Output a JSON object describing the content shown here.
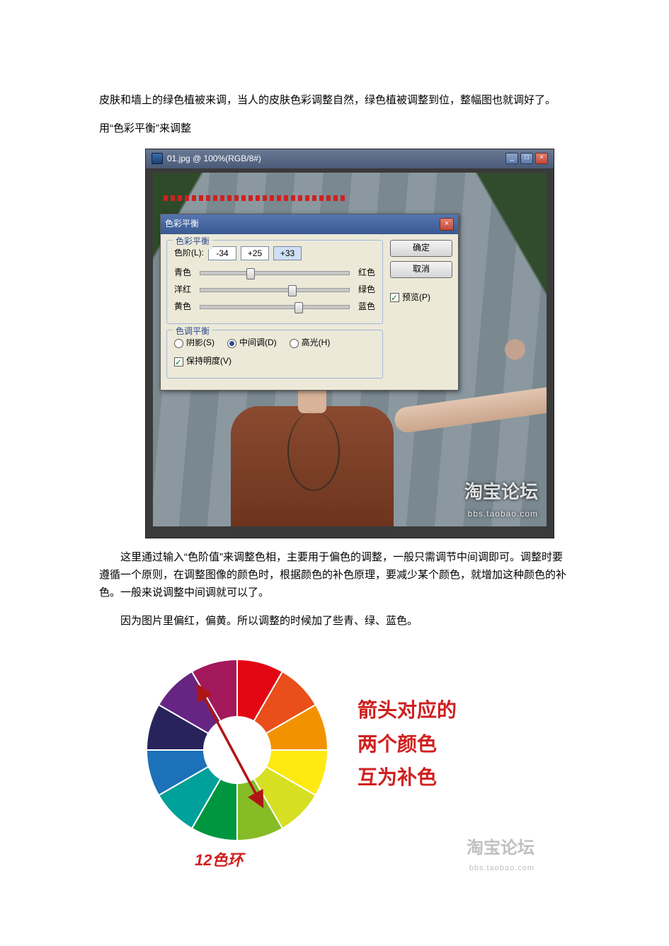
{
  "intro": {
    "p1": "皮肤和墙上的绿色植被来调，当人的皮肤色彩调整自然，绿色植被调整到位，整幅图也就调好了。",
    "p2": "用“色彩平衡”来调整"
  },
  "ps": {
    "doc_title": "01.jpg @ 100%(RGB/8#)",
    "dialog_title": "色彩平衡",
    "group1_legend": "色彩平衡",
    "levels_label": "色阶(L):",
    "levels": [
      "-34",
      "+25",
      "+33"
    ],
    "sliders": [
      {
        "left": "青色",
        "right": "红色",
        "pos": 34
      },
      {
        "left": "洋红",
        "right": "绿色",
        "pos": 62
      },
      {
        "left": "黄色",
        "right": "蓝色",
        "pos": 66
      }
    ],
    "group2_legend": "色调平衡",
    "tone_options": {
      "shadows": "阴影(S)",
      "midtones": "中间调(D)",
      "highlights": "高光(H)"
    },
    "preserve_lum": "保持明度(V)",
    "buttons": {
      "ok": "确定",
      "cancel": "取消"
    },
    "preview": "预览(P)",
    "watermark_main": "淘宝论坛",
    "watermark_sub": "bbs.taobao.com"
  },
  "body": {
    "p1": "这里通过输入“色阶值”来调整色相，主要用于偏色的调整，一般只需调节中间调即可。调整时要遵循一个原则，在调整图像的颜色时，根据颜色的补色原理，要减少某个颜色，就增加这种颜色的补色。一般来说调整中间调就可以了。",
    "p2": "因为图片里偏红，偏黄。所以调整的时候加了些青、绿、蓝色。"
  },
  "wheel": {
    "caption": "12色环",
    "text_l1": "箭头对应的",
    "text_l2": "两个颜色",
    "text_l3": "互为补色",
    "watermark_main": "淘宝论坛",
    "watermark_sub": "bbs.taobao.com",
    "colors": [
      "#e30613",
      "#e94e1b",
      "#f39200",
      "#fcea10",
      "#d7df23",
      "#86bc25",
      "#009640",
      "#00a19a",
      "#1d71b8",
      "#29235c",
      "#662483",
      "#a3195b"
    ]
  }
}
